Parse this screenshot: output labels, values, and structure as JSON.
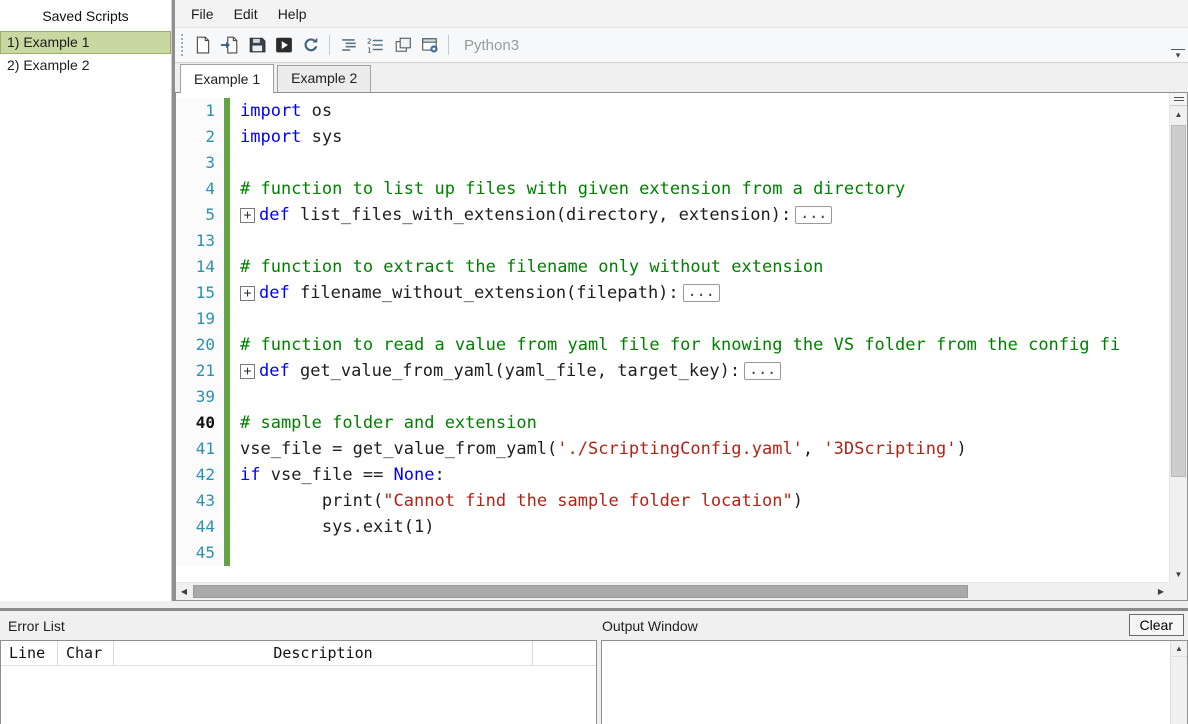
{
  "sidebar": {
    "title": "Saved Scripts",
    "items": [
      {
        "label": "1) Example 1",
        "selected": true
      },
      {
        "label": "2) Example 2",
        "selected": false
      }
    ]
  },
  "menu": {
    "items": [
      "File",
      "Edit",
      "Help"
    ]
  },
  "toolbar": {
    "language_label": "Python3",
    "icons": [
      "new-script",
      "import-script",
      "save-script",
      "run-script",
      "reload-script",
      "word-wrap",
      "line-numbers",
      "duplicate-window",
      "script-settings"
    ]
  },
  "tabs": [
    {
      "label": "Example 1",
      "active": true
    },
    {
      "label": "Example 2",
      "active": false
    }
  ],
  "editor": {
    "current_line": 40,
    "lines": [
      {
        "num": "1",
        "segs": [
          [
            "k",
            "import"
          ],
          [
            "p",
            " os"
          ]
        ]
      },
      {
        "num": "2",
        "segs": [
          [
            "k",
            "import"
          ],
          [
            "p",
            " sys"
          ]
        ]
      },
      {
        "num": "3",
        "segs": []
      },
      {
        "num": "4",
        "segs": [
          [
            "c",
            "# function to list up files with given extension from a directory"
          ]
        ]
      },
      {
        "num": "5",
        "fold": true,
        "ellipsis": true,
        "segs": [
          [
            "k",
            "def"
          ],
          [
            "p",
            " list_files_with_extension(directory, extension):"
          ]
        ]
      },
      {
        "num": "13",
        "segs": []
      },
      {
        "num": "14",
        "segs": [
          [
            "c",
            "# function to extract the filename only without extension"
          ]
        ]
      },
      {
        "num": "15",
        "fold": true,
        "ellipsis": true,
        "segs": [
          [
            "k",
            "def"
          ],
          [
            "p",
            " filename_without_extension(filepath):"
          ]
        ]
      },
      {
        "num": "19",
        "segs": []
      },
      {
        "num": "20",
        "segs": [
          [
            "c",
            "# function to read a value from yaml file for knowing the VS folder from the config fi"
          ]
        ]
      },
      {
        "num": "21",
        "fold": true,
        "ellipsis": true,
        "segs": [
          [
            "k",
            "def"
          ],
          [
            "p",
            " get_value_from_yaml(yaml_file, target_key):"
          ]
        ]
      },
      {
        "num": "39",
        "segs": []
      },
      {
        "num": "40",
        "current": true,
        "segs": [
          [
            "c",
            "# sample folder and extension"
          ]
        ]
      },
      {
        "num": "41",
        "segs": [
          [
            "p",
            "vse_file = get_value_from_yaml("
          ],
          [
            "s",
            "'./ScriptingConfig.yaml'"
          ],
          [
            "p",
            ", "
          ],
          [
            "s",
            "'3DScripting'"
          ],
          [
            "p",
            ")"
          ]
        ]
      },
      {
        "num": "42",
        "segs": [
          [
            "k",
            "if"
          ],
          [
            "p",
            " vse_file == "
          ],
          [
            "k",
            "None"
          ],
          [
            "p",
            ":"
          ]
        ]
      },
      {
        "num": "43",
        "segs": [
          [
            "p",
            "        print("
          ],
          [
            "s",
            "\"Cannot find the sample folder location\""
          ],
          [
            "p",
            ")"
          ]
        ]
      },
      {
        "num": "44",
        "segs": [
          [
            "p",
            "        sys.exit(1)"
          ]
        ]
      },
      {
        "num": "45",
        "segs": []
      }
    ]
  },
  "bottom": {
    "error_list": {
      "title": "Error List",
      "columns": [
        "Line",
        "Char",
        "Description"
      ]
    },
    "output": {
      "title": "Output Window",
      "clear_label": "Clear"
    }
  },
  "colors": {
    "keyword": "#0000ff",
    "comment": "#008000",
    "string": "#b02418",
    "line-num": "#2b91af",
    "change-bar": "#62a642",
    "select-green": "#c8d8a0"
  }
}
